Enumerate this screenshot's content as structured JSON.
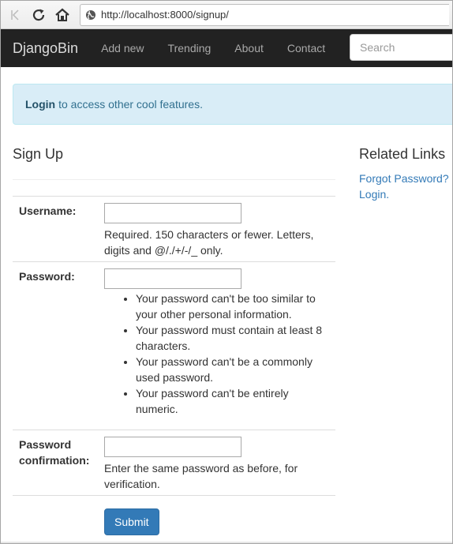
{
  "browser": {
    "url": "http://localhost:8000/signup/",
    "icons": [
      "back-icon",
      "reload-icon",
      "home-icon",
      "globe-icon"
    ]
  },
  "navbar": {
    "brand": "DjangoBin",
    "links": [
      "Add new",
      "Trending",
      "About",
      "Contact"
    ],
    "search_placeholder": "Search"
  },
  "alert": {
    "link": "Login",
    "text": "to access other cool features."
  },
  "signup": {
    "title": "Sign Up",
    "username_label": "Username:",
    "username_help": "Required. 150 characters or fewer. Letters, digits and @/./+/-/_ only.",
    "password_label": "Password:",
    "password_rules": [
      "Your password can't be too similar to your other personal information.",
      "Your password must contain at least 8 characters.",
      "Your password can't be a commonly used password.",
      "Your password can't be entirely numeric."
    ],
    "confirm_label": "Password confirmation:",
    "confirm_help": "Enter the same password as before, for verification.",
    "submit": "Submit"
  },
  "sidebar": {
    "title": "Related Links",
    "links": [
      "Forgot Password?",
      "Login."
    ]
  },
  "colors": {
    "navbar_bg": "#222222",
    "alert_bg": "#d9edf7",
    "link": "#337ab7",
    "button": "#337ab7"
  }
}
